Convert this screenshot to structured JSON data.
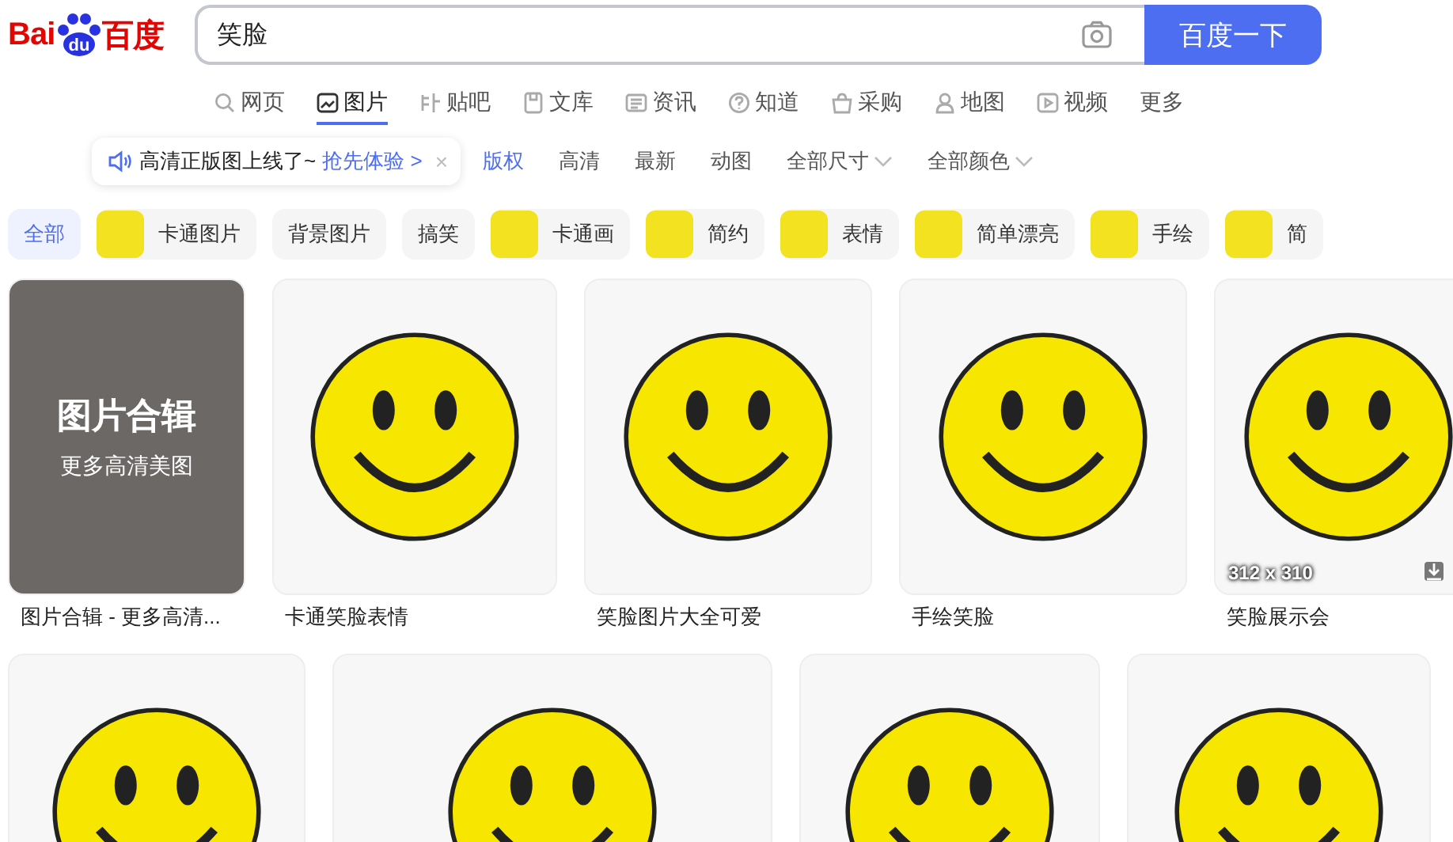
{
  "logo": {
    "left": "Bai",
    "paw": "du",
    "right": "百度"
  },
  "search": {
    "value": "笑脸",
    "button": "百度一下"
  },
  "nav": [
    {
      "label": "网页",
      "kind": "search",
      "selected": false
    },
    {
      "label": "图片",
      "kind": "image",
      "selected": true
    },
    {
      "label": "贴吧",
      "kind": "tieba",
      "selected": false
    },
    {
      "label": "文库",
      "kind": "doc",
      "selected": false
    },
    {
      "label": "资讯",
      "kind": "news",
      "selected": false
    },
    {
      "label": "知道",
      "kind": "question",
      "selected": false
    },
    {
      "label": "采购",
      "kind": "bag",
      "selected": false
    },
    {
      "label": "地图",
      "kind": "map",
      "selected": false
    },
    {
      "label": "视频",
      "kind": "video",
      "selected": false
    },
    {
      "label": "更多",
      "kind": "none",
      "selected": false
    }
  ],
  "notice": {
    "text": "高清正版图上线了~",
    "link": "抢先体验 >",
    "close": "×"
  },
  "filters": [
    {
      "label": "版权",
      "emphasized": true,
      "dropdown": false
    },
    {
      "label": "高清",
      "emphasized": false,
      "dropdown": false
    },
    {
      "label": "最新",
      "emphasized": false,
      "dropdown": false
    },
    {
      "label": "动图",
      "emphasized": false,
      "dropdown": false
    },
    {
      "label": "全部尺寸",
      "emphasized": false,
      "dropdown": true
    },
    {
      "label": "全部颜色",
      "emphasized": false,
      "dropdown": true
    }
  ],
  "tags": [
    {
      "label": "全部",
      "selected": true,
      "thumb": false
    },
    {
      "label": "卡通图片",
      "selected": false,
      "thumb": true
    },
    {
      "label": "背景图片",
      "selected": false,
      "thumb": false
    },
    {
      "label": "搞笑",
      "selected": false,
      "thumb": false
    },
    {
      "label": "卡通画",
      "selected": false,
      "thumb": true
    },
    {
      "label": "简约",
      "selected": false,
      "thumb": true
    },
    {
      "label": "表情",
      "selected": false,
      "thumb": true
    },
    {
      "label": "简单漂亮",
      "selected": false,
      "thumb": true
    },
    {
      "label": "手绘",
      "selected": false,
      "thumb": true
    },
    {
      "label": "简",
      "selected": false,
      "thumb": true
    }
  ],
  "results": [
    {
      "items": [
        {
          "kind": "album",
          "title": "图片合辑",
          "subtitle": "更多高清美图",
          "caption": "图片合辑 - 更多高清..."
        },
        {
          "kind": "image",
          "caption": "卡通笑脸表情"
        },
        {
          "kind": "image",
          "caption": "笑脸图片大全可爱"
        },
        {
          "kind": "image",
          "caption": "手绘笑脸"
        },
        {
          "kind": "image",
          "caption": "笑脸展示会",
          "size": "312 x 310"
        }
      ]
    },
    {
      "items": [
        {
          "kind": "image"
        },
        {
          "kind": "image"
        },
        {
          "kind": "image"
        },
        {
          "kind": "image"
        }
      ]
    }
  ]
}
